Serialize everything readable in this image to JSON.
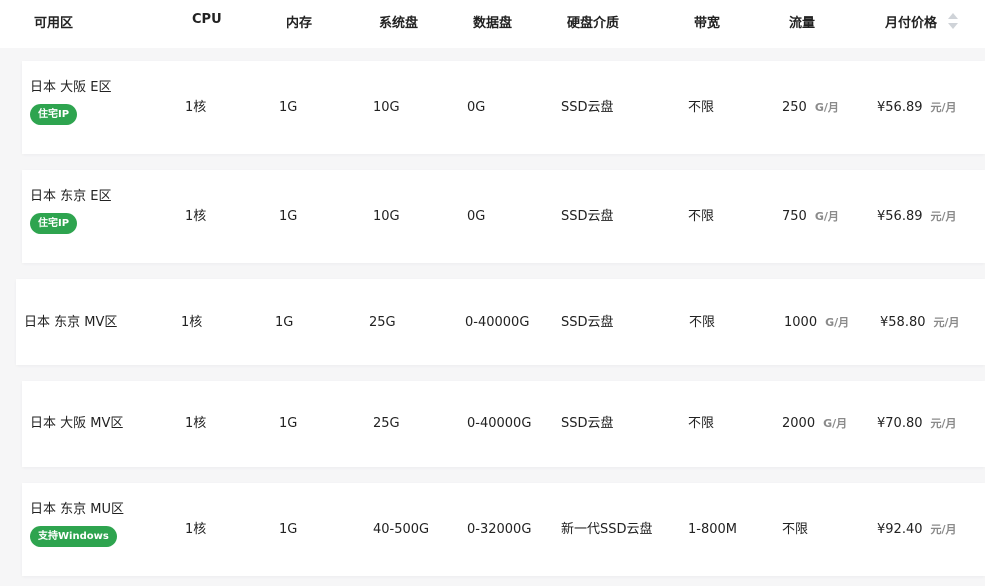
{
  "header": {
    "zone": "可用区",
    "cpu": "CPU",
    "memory": "内存",
    "system_disk": "系统盘",
    "data_disk": "数据盘",
    "disk_media": "硬盘介质",
    "bandwidth": "带宽",
    "traffic": "流量",
    "price": "月付价格",
    "sort_icon": "sort-icon"
  },
  "units": {
    "traffic": "G/月",
    "price": "元/月"
  },
  "rows": [
    {
      "zone": "日本 大阪 E区",
      "badge": "住宅IP",
      "cpu": "1核",
      "memory": "1G",
      "system_disk": "10G",
      "data_disk": "0G",
      "disk_media": "SSD云盘",
      "bandwidth": "不限",
      "traffic": "250",
      "price": "¥56.89"
    },
    {
      "zone": "日本 东京 E区",
      "badge": "住宅IP",
      "cpu": "1核",
      "memory": "1G",
      "system_disk": "10G",
      "data_disk": "0G",
      "disk_media": "SSD云盘",
      "bandwidth": "不限",
      "traffic": "750",
      "price": "¥56.89"
    },
    {
      "zone": "日本 东京 MV区",
      "cpu": "1核",
      "memory": "1G",
      "system_disk": "25G",
      "data_disk": "0-40000G",
      "disk_media": "SSD云盘",
      "bandwidth": "不限",
      "traffic": "1000",
      "price": "¥58.80"
    },
    {
      "zone": "日本 大阪 MV区",
      "cpu": "1核",
      "memory": "1G",
      "system_disk": "25G",
      "data_disk": "0-40000G",
      "disk_media": "SSD云盘",
      "bandwidth": "不限",
      "traffic": "2000",
      "price": "¥70.80"
    },
    {
      "zone": "日本 东京 MU区",
      "badge": "支持Windows",
      "cpu": "1核",
      "memory": "1G",
      "system_disk": "40-500G",
      "data_disk": "0-32000G",
      "disk_media": "新一代SSD云盘",
      "bandwidth": "1-800M",
      "traffic_text": "不限",
      "price": "¥92.40"
    }
  ],
  "colors": {
    "badge": "#2ea44f",
    "background": "#f6f6f7",
    "row": "#ffffff",
    "unit": "#8a8a8a"
  }
}
